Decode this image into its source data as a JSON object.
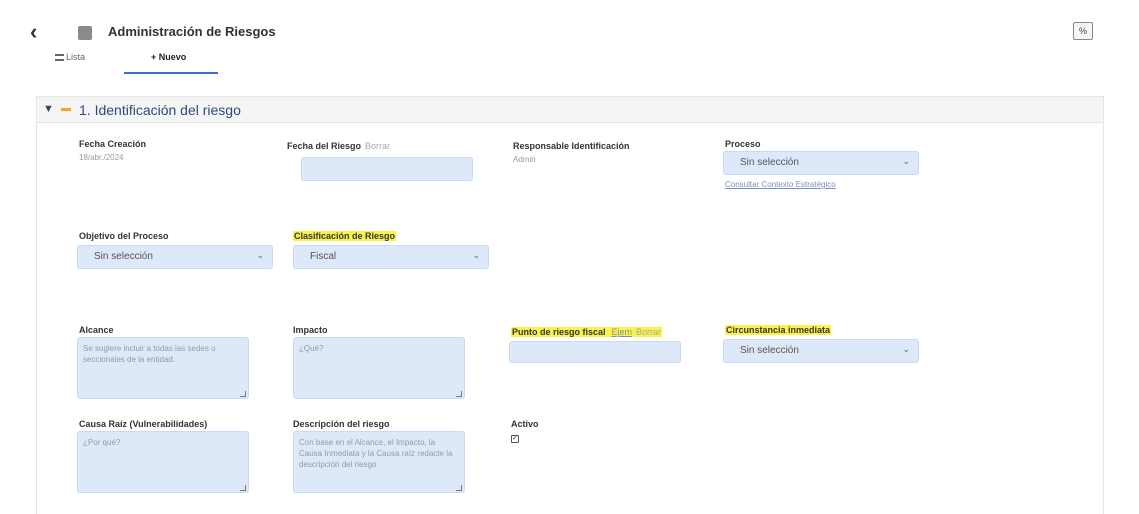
{
  "header": {
    "title": "Administración de Riesgos",
    "top_right_button": "%",
    "back_icon": "chevron-left-icon",
    "app_icon": "module-icon"
  },
  "tabs": [
    {
      "label": "Lista",
      "icon": "list-icon"
    },
    {
      "label": "Nuevo",
      "icon": "plus-icon",
      "active": true
    }
  ],
  "section": {
    "title": "1. Identificación del riesgo",
    "accent_color": "#f0a62a",
    "title_color": "#2d4a7a"
  },
  "fields": {
    "fecha_creacion": {
      "label": "Fecha Creación",
      "value": "18/abr./2024"
    },
    "fecha_riesgo": {
      "label": "Fecha del Riesgo",
      "hint": "Borrar",
      "value": ""
    },
    "responsable": {
      "label": "Responsable Identificación",
      "value": "Admin"
    },
    "proceso": {
      "label": "Proceso",
      "value": "Sin selección",
      "link": "Consultar Contexto Estratégico"
    },
    "objetivo": {
      "label": "Objetivo del Proceso",
      "value": "Sin selección"
    },
    "clasificacion": {
      "label": "Clasificación de Riesgo",
      "value": "Fiscal"
    },
    "alcance": {
      "label": "Alcance",
      "placeholder": "Se sugiere incluir a todas las sedes o seccionales de la entidad."
    },
    "impacto": {
      "label": "Impacto",
      "placeholder": "¿Qué?"
    },
    "punto_riesgo": {
      "label": "Punto de riesgo fiscal",
      "link": "Ejem",
      "hint": "Borrar",
      "value": ""
    },
    "circunstancia": {
      "label": "Circunstancia inmediata",
      "value": "Sin selección"
    },
    "causa_raiz": {
      "label": "Causa Raíz (Vulnerabilidades)",
      "placeholder": "¿Por qué?"
    },
    "descripcion": {
      "label": "Descripción del riesgo",
      "placeholder": "Con base en el Alcance, el Impacto, la Causa Inmediata y la Causa raíz redacte la descripción del riesgo"
    },
    "activo": {
      "label": "Activo",
      "checked": true,
      "check_glyph": "✓"
    }
  },
  "colors": {
    "input_bg": "#dde9f9",
    "highlight": "#fbf24a",
    "tab_underline": "#3b6fd8"
  }
}
